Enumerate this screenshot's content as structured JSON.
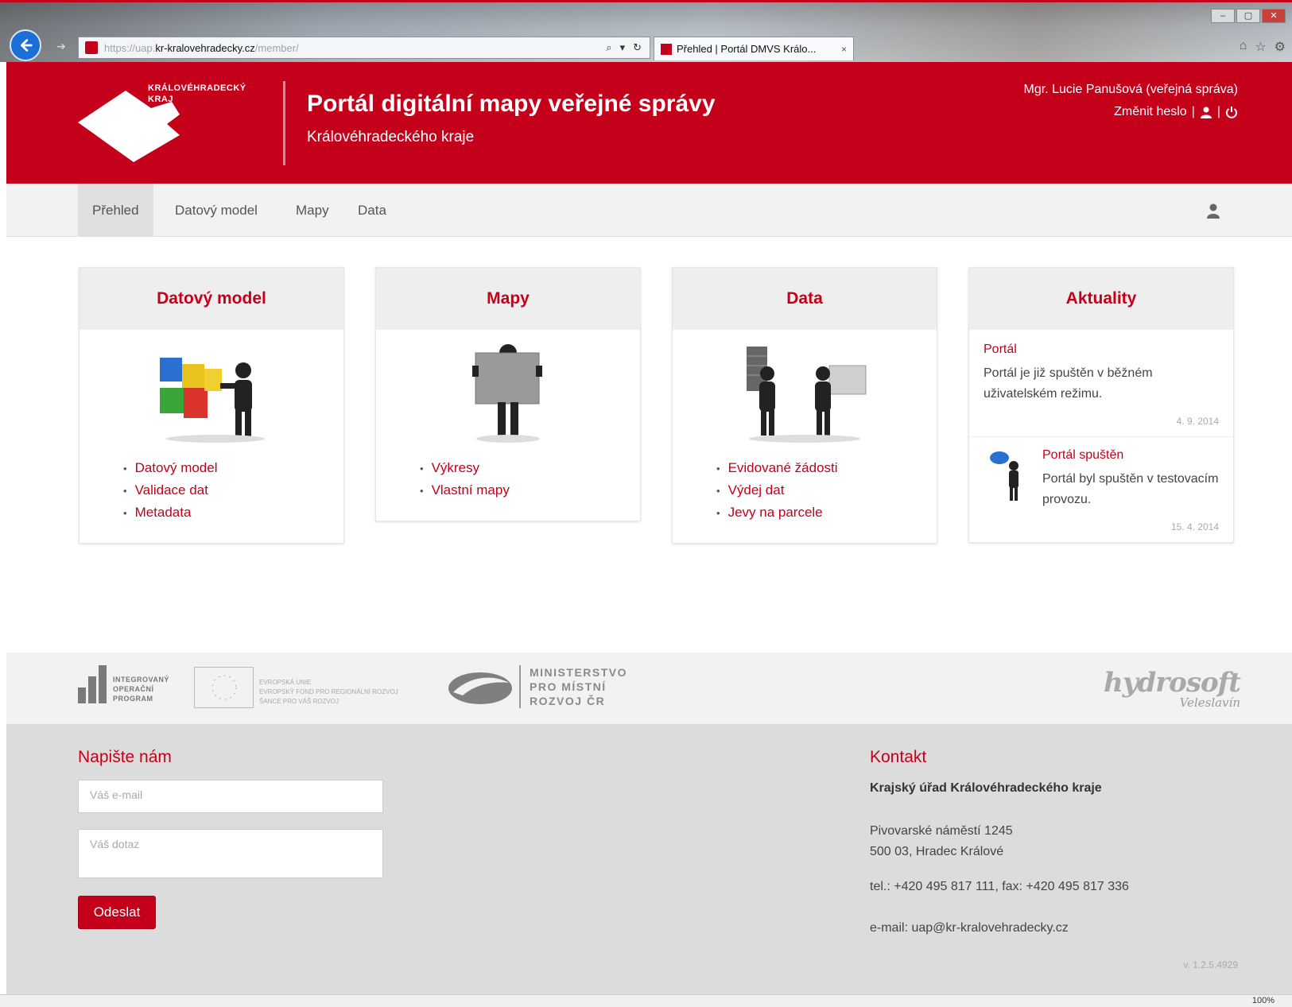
{
  "browser": {
    "url_prefix": "https://uap.",
    "url_domain": "kr-kralovehradecky.cz",
    "url_suffix": "/member/",
    "tab_title": "Přehled | Portál DMVS Králo...",
    "tab_close": "×",
    "zoom": "100%"
  },
  "header": {
    "logo_text": "KRÁLOVÉHRADECKÝ\nKRAJ",
    "title": "Portál digitální mapy veřejné správy",
    "subtitle": "Královéhradeckého kraje",
    "user": "Mgr. Lucie Panušová (veřejná správa)",
    "change_password": "Změnit heslo",
    "separator": "|",
    "brand_color": "#c4001a"
  },
  "nav": {
    "items": [
      {
        "label": "Přehled",
        "active": true
      },
      {
        "label": "Datový model",
        "active": false
      },
      {
        "label": "Mapy",
        "active": false
      },
      {
        "label": "Data",
        "active": false
      }
    ]
  },
  "cards": {
    "datovy_model": {
      "title": "Datový model",
      "links": [
        "Datový model",
        "Validace dat",
        "Metadata"
      ]
    },
    "mapy": {
      "title": "Mapy",
      "links": [
        "Výkresy",
        "Vlastní mapy"
      ]
    },
    "data": {
      "title": "Data",
      "links": [
        "Evidované žádosti",
        "Výdej dat",
        "Jevy na parcele"
      ]
    },
    "aktuality": {
      "title": "Aktuality",
      "items": [
        {
          "title": "Portál",
          "text": "Portál je již spuštěn v běžném uživatelském režimu.",
          "date": "4. 9. 2014"
        },
        {
          "title": "Portál spuštěn",
          "text": "Portál byl spuštěn v testovacím provozu.",
          "date": "15. 4. 2014"
        }
      ]
    }
  },
  "partners": {
    "iop": "INTEGROVANÝ\nOPERAČNÍ\nPROGRAM",
    "eu": "EVROPSKÁ UNIE\nEVROPSKÝ FOND PRO REGIONÁLNÍ ROZVOJ\nŠANCE PRO VÁŠ ROZVOJ",
    "mmr": "MINISTERSTVO\nPRO MÍSTNÍ\nROZVOJ ČR",
    "hydrosoft": "hydrosoft",
    "hydrosoft_sub": "Veleslavín"
  },
  "footer": {
    "contact_heading": "Napište nám",
    "email_placeholder": "Váš e-mail",
    "query_placeholder": "Váš dotaz",
    "submit_label": "Odeslat",
    "kontakt_heading": "Kontakt",
    "org": "Krajský úřad Královéhradeckého kraje",
    "street": "Pivovarské náměstí 1245",
    "city": "500 03, Hradec Králové",
    "phone": "tel.: +420 495 817 111, fax: +420 495 817 336",
    "email": "e-mail: uap@kr-kralovehradecky.cz",
    "version": "v. 1.2.5.4929"
  }
}
